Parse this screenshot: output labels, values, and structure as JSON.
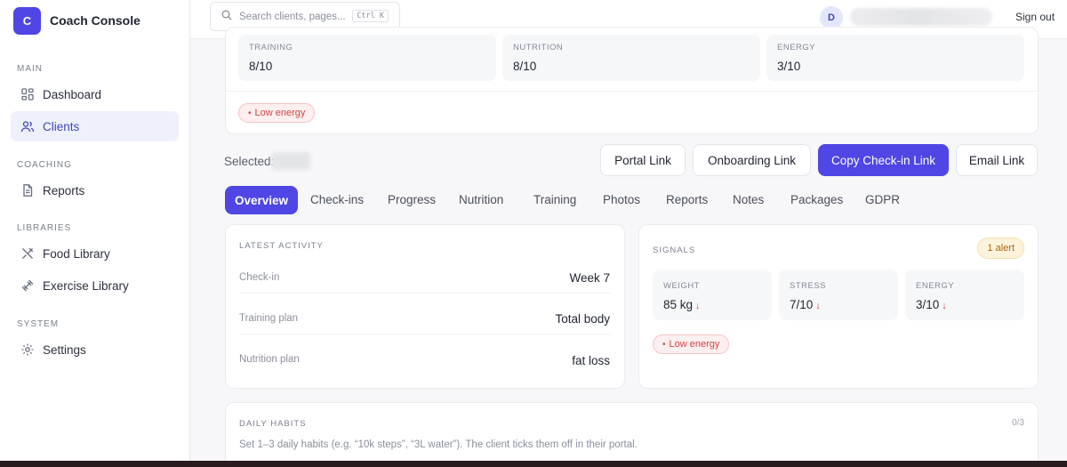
{
  "app": {
    "logo_letter": "C",
    "name": "Coach Console"
  },
  "sidebar": {
    "sections": [
      {
        "label": "MAIN"
      },
      {
        "label": "COACHING"
      },
      {
        "label": "LIBRARIES"
      },
      {
        "label": "SYSTEM"
      }
    ],
    "items": [
      {
        "label": "Dashboard",
        "icon": "dashboard-grid-icon"
      },
      {
        "label": "Clients",
        "icon": "users-icon",
        "active": true
      },
      {
        "label": "Reports",
        "icon": "document-icon"
      },
      {
        "label": "Food Library",
        "icon": "utensils-icon"
      },
      {
        "label": "Exercise Library",
        "icon": "dumbbell-icon"
      },
      {
        "label": "Settings",
        "icon": "gear-icon"
      }
    ]
  },
  "topbar": {
    "search_placeholder": "Search clients, pages...",
    "search_shortcut": "Ctrl K",
    "avatar_initial": "D",
    "signout_label": "Sign out"
  },
  "summary": {
    "metrics": [
      {
        "label": "TRAINING",
        "value": "8/10"
      },
      {
        "label": "NUTRITION",
        "value": "8/10"
      },
      {
        "label": "ENERGY",
        "value": "3/10"
      }
    ],
    "flag": "Low energy"
  },
  "selection": {
    "label": "Selected:"
  },
  "actions": [
    {
      "label": "Portal Link"
    },
    {
      "label": "Onboarding Link"
    },
    {
      "label": "Copy Check-in Link",
      "primary": true
    },
    {
      "label": "Email Link"
    }
  ],
  "tabs": [
    {
      "label": "Overview",
      "active": true
    },
    {
      "label": "Check-ins"
    },
    {
      "label": "Progress"
    },
    {
      "label": "Nutrition"
    },
    {
      "label": "Training"
    },
    {
      "label": "Photos"
    },
    {
      "label": "Reports"
    },
    {
      "label": "Notes"
    },
    {
      "label": "Packages"
    },
    {
      "label": "GDPR"
    }
  ],
  "latest_activity": {
    "title": "LATEST ACTIVITY",
    "rows": [
      {
        "label": "Check-in",
        "value": "Week 7"
      },
      {
        "label": "Training plan",
        "value": "Total body"
      },
      {
        "label": "Nutrition plan",
        "value": "fat loss"
      }
    ]
  },
  "signals": {
    "title": "SIGNALS",
    "alert_badge": "1 alert",
    "metrics": [
      {
        "label": "WEIGHT",
        "value": "85 kg",
        "trend": "↓"
      },
      {
        "label": "STRESS",
        "value": "7/10",
        "trend": "↓"
      },
      {
        "label": "ENERGY",
        "value": "3/10",
        "trend": "↓"
      }
    ],
    "flag": "Low energy"
  },
  "daily_habits": {
    "title": "DAILY HABITS",
    "count": "0/3",
    "description": "Set 1–3 daily habits (e.g. “10k steps”, “3L water”). The client ticks them off in their portal."
  },
  "colors": {
    "accent": "#4f46e5",
    "danger": "#d14343",
    "warning": "#a66a10"
  }
}
